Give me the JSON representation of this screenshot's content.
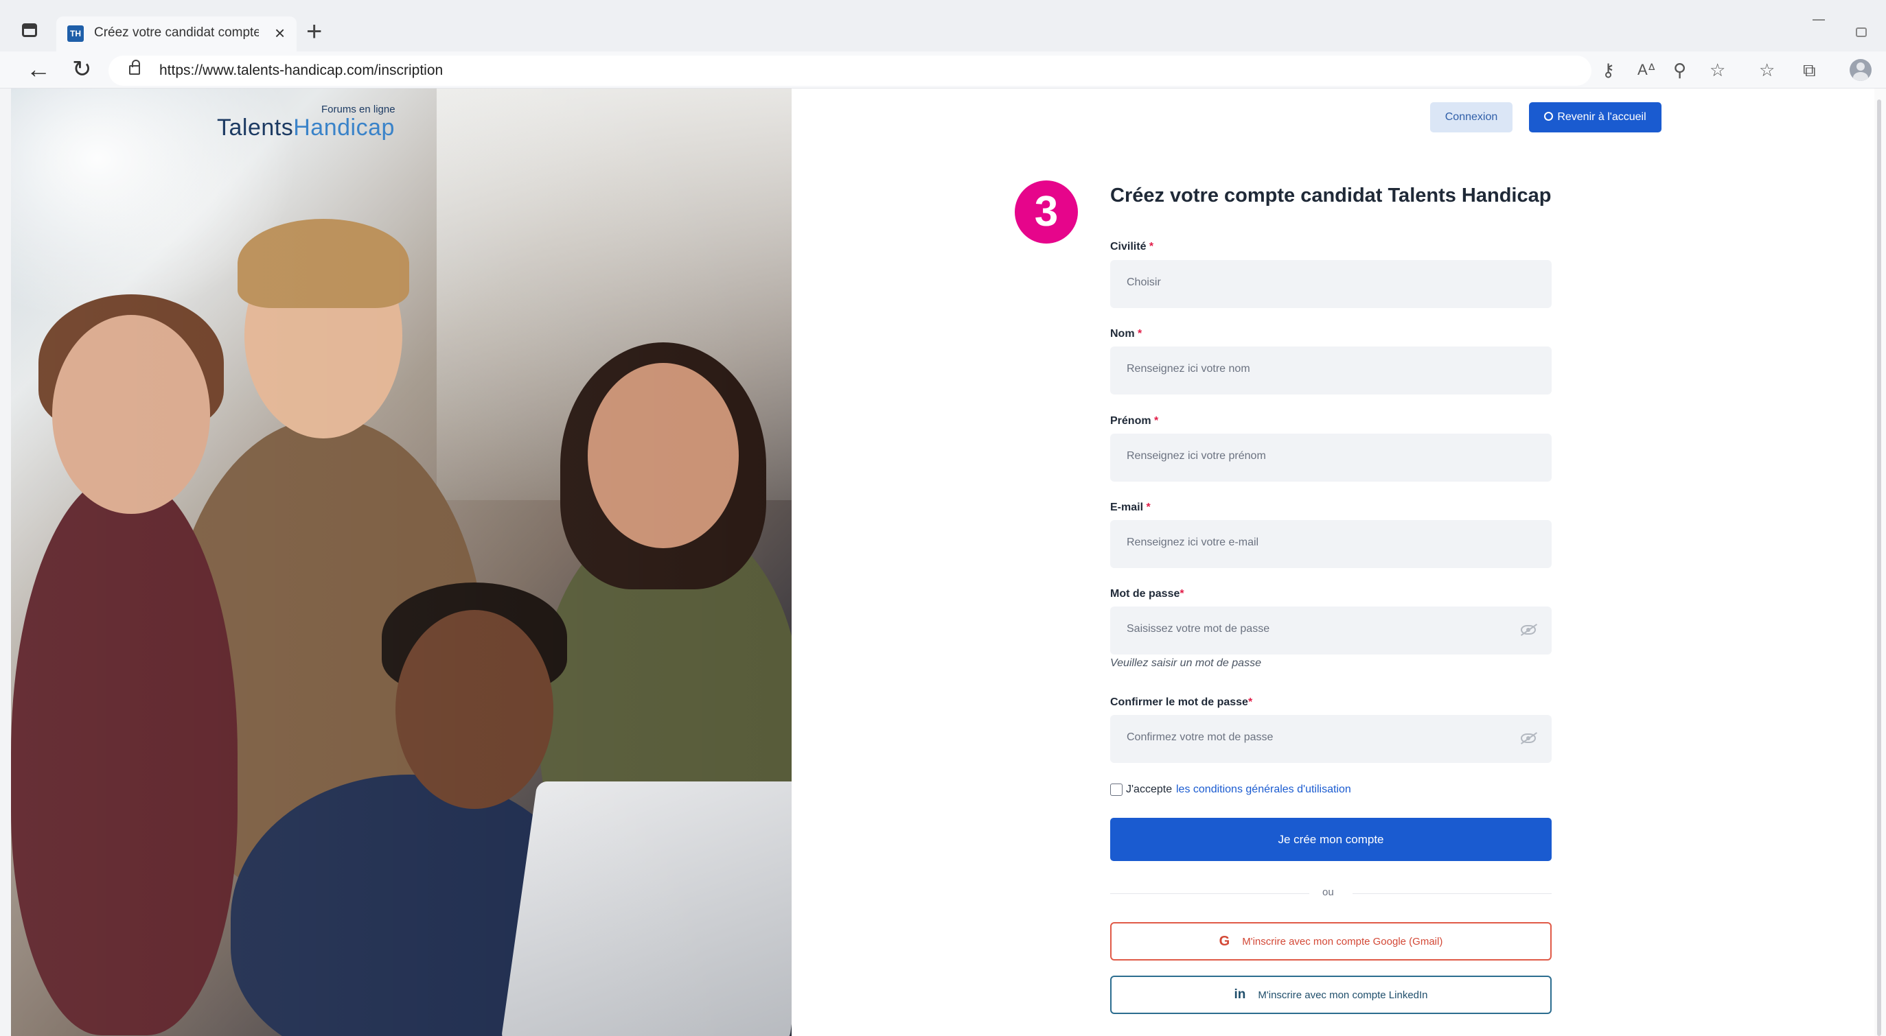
{
  "browser": {
    "tab_title": "Créez votre candidat compte Tal",
    "favicon_text": "TH",
    "tab_close": "×",
    "new_tab": "+",
    "back": "←",
    "reload": "↻",
    "url": "https://www.talents-handicap.com/inscription",
    "toolbar_icons": [
      "key-icon",
      "read-aloud-icon",
      "zoom-icon",
      "favorite-add-icon",
      "favorites-icon",
      "collections-icon",
      "profile-icon"
    ]
  },
  "logo": {
    "part1": "Talents",
    "part2": "Handicap",
    "tagline": "Forums en ligne"
  },
  "header": {
    "login_label": "Connexion",
    "home_label": "Revenir à l'accueil"
  },
  "step_badge": "3",
  "form": {
    "title": "Créez votre compte candidat Talents Handicap",
    "required_mark": "*",
    "civility": {
      "label": "Civilité",
      "placeholder": "Choisir"
    },
    "last_name": {
      "label": "Nom",
      "placeholder": "Renseignez ici votre nom"
    },
    "first_name": {
      "label": "Prénom",
      "placeholder": "Renseignez ici votre prénom"
    },
    "email": {
      "label": "E-mail",
      "placeholder": "Renseignez ici votre e-mail"
    },
    "password": {
      "label": "Mot de passe",
      "placeholder": "Saisissez votre mot de passe",
      "hint": "Veuillez saisir un mot de passe"
    },
    "password_confirm": {
      "label": "Confirmer le mot de passe",
      "placeholder": "Confirmez votre mot de passe"
    },
    "terms_prefix": "J'accepte",
    "terms_link": "les conditions générales d'utilisation",
    "submit_label": "Je crée mon compte",
    "separator": "ou",
    "google_icon": "G",
    "google_label": "M'inscrire avec mon compte Google (Gmail)",
    "linkedin_icon": "in",
    "linkedin_label": "M'inscrire avec mon compte LinkedIn"
  },
  "colors": {
    "primary": "#1a5bd0",
    "badge": "#e6058b",
    "google": "#d34836",
    "linkedin": "#2c6d8f"
  }
}
